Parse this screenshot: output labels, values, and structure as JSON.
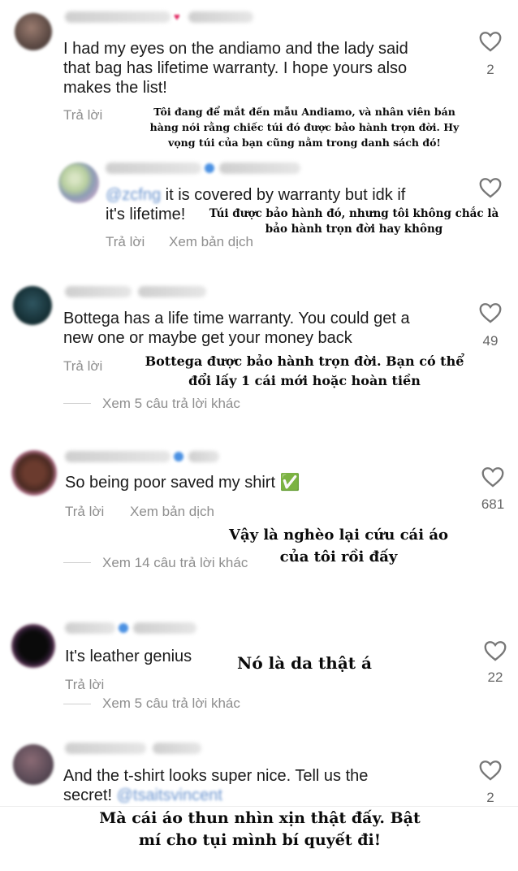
{
  "comments": [
    {
      "text": "I had my eyes on the andiamo and the lady said that bag has lifetime warranty. I hope yours also makes the list!",
      "line1": "I had my eyes on the andiamo and the lady said",
      "line2": "that bag has lifetime warranty. I hope yours also",
      "line3": "makes the list!",
      "reply_label": "Trả lời",
      "likes": "2",
      "translation_line1": "Tôi đang để mắt đến mẫu Andiamo, và nhân viên bán",
      "translation_line2": "hàng nói rằng chiếc túi đó được bảo hành trọn đời. Hy",
      "translation_line3": "vọng túi của bạn cũng nằm trong danh sách đó!"
    },
    {
      "mention": "@zcfng",
      "line1": " it is covered by warranty but idk if",
      "line2": "it's lifetime!",
      "reply_label": "Trả lời",
      "translate_label": "Xem bản dịch",
      "translation_line1": "Túi được bảo hành đó, nhưng tôi không chắc là",
      "translation_line2": "bảo hành trọn đời hay không"
    },
    {
      "line1": "Bottega has a life time warranty. You could get a",
      "line2": "new one or maybe get your money back",
      "reply_label": "Trả lời",
      "likes": "49",
      "more_replies": "Xem 5 câu trả lời khác",
      "translation_line1": "Bottega được bảo hành trọn đời. Bạn có thể",
      "translation_line2": "đổi lấy 1 cái mới hoặc hoàn tiền"
    },
    {
      "line1": "So being poor saved my shirt ✅",
      "reply_label": "Trả lời",
      "translate_label": "Xem bản dịch",
      "likes": "681",
      "more_replies": "Xem 14 câu trả lời khác",
      "translation_line1": "Vậy là nghèo lại cứu cái áo",
      "translation_line2": "của tôi rồi đấy"
    },
    {
      "line1": "It's leather genius",
      "reply_label": "Trả lời",
      "likes": "22",
      "more_replies": "Xem 5 câu trả lời khác",
      "translation_line1": "Nó là da thật á"
    },
    {
      "line1": "And the t-shirt looks super nice. Tell us the",
      "line2": "secret! ",
      "mention": "@tsaitsvincent",
      "likes": "2",
      "translation_line1": "Mà cái áo thun nhìn xịn thật đấy. Bật",
      "translation_line2": "mí cho tụi mình bí quyết đi!"
    }
  ],
  "colors": {
    "text": "#1a1a1a",
    "muted": "#8e8e8e",
    "mention": "#6a94cf",
    "verified": "#4a90e2",
    "heart_red": "#e0245e"
  },
  "icons": {
    "like": "heart-outline-icon",
    "verified": "verified-badge-icon"
  }
}
